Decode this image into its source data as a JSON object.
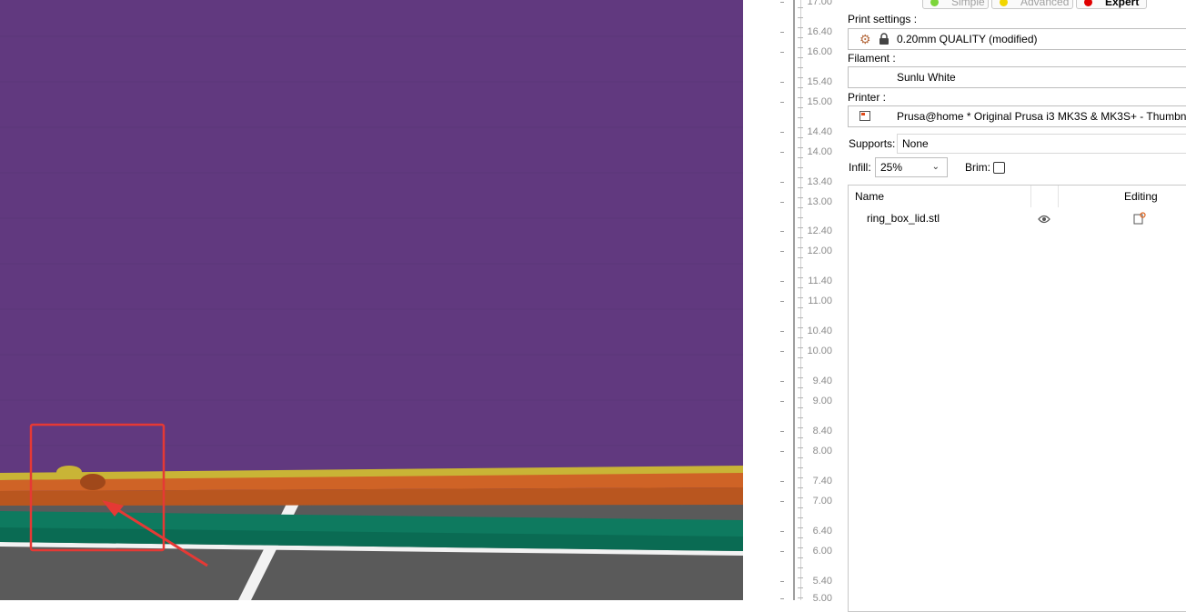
{
  "mode_buttons": [
    {
      "label": "Simple",
      "color": "#7cd53a"
    },
    {
      "label": "Advanced",
      "color": "#f2d600"
    },
    {
      "label": "Expert",
      "color": "#e00000"
    }
  ],
  "print_settings": {
    "label": "Print settings :",
    "value": "0.20mm QUALITY (modified)"
  },
  "filament": {
    "label": "Filament :",
    "value": "Sunlu White"
  },
  "printer": {
    "label": "Printer :",
    "value": "Prusa@home * Original Prusa i3 MK3S & MK3S+ - Thumbna"
  },
  "supports": {
    "label": "Supports:",
    "value": "None"
  },
  "infill": {
    "label": "Infill:",
    "value": "25%"
  },
  "brim": {
    "label": "Brim:",
    "checked": false
  },
  "object_list": {
    "columns": [
      "Name",
      "Editing"
    ],
    "rows": [
      {
        "name": "ring_box_lid.stl"
      }
    ]
  },
  "slider_ticks": [
    {
      "label": "17.00"
    },
    {
      "label": "16.40"
    },
    {
      "label": "16.00"
    },
    {
      "label": "15.40"
    },
    {
      "label": "15.00"
    },
    {
      "label": "14.40"
    },
    {
      "label": "14.00"
    },
    {
      "label": "13.40"
    },
    {
      "label": "13.00"
    },
    {
      "label": "12.40"
    },
    {
      "label": "12.00"
    },
    {
      "label": "11.40"
    },
    {
      "label": "11.00"
    },
    {
      "label": "10.40"
    },
    {
      "label": "10.00"
    },
    {
      "label": "9.40"
    },
    {
      "label": "9.00"
    },
    {
      "label": "8.40"
    },
    {
      "label": "8.00"
    },
    {
      "label": "7.40"
    },
    {
      "label": "7.00"
    },
    {
      "label": "6.40"
    },
    {
      "label": "6.00"
    },
    {
      "label": "5.40"
    },
    {
      "label": "5.00"
    }
  ],
  "colors": {
    "model_purple": "#61397f",
    "perimeter_orange": "#cf6326",
    "perimeter_yellow": "#c9b436",
    "perimeter_green": "#0e7a5f",
    "bed_gray": "#5a5a5a",
    "annotation_red": "#e53935"
  }
}
